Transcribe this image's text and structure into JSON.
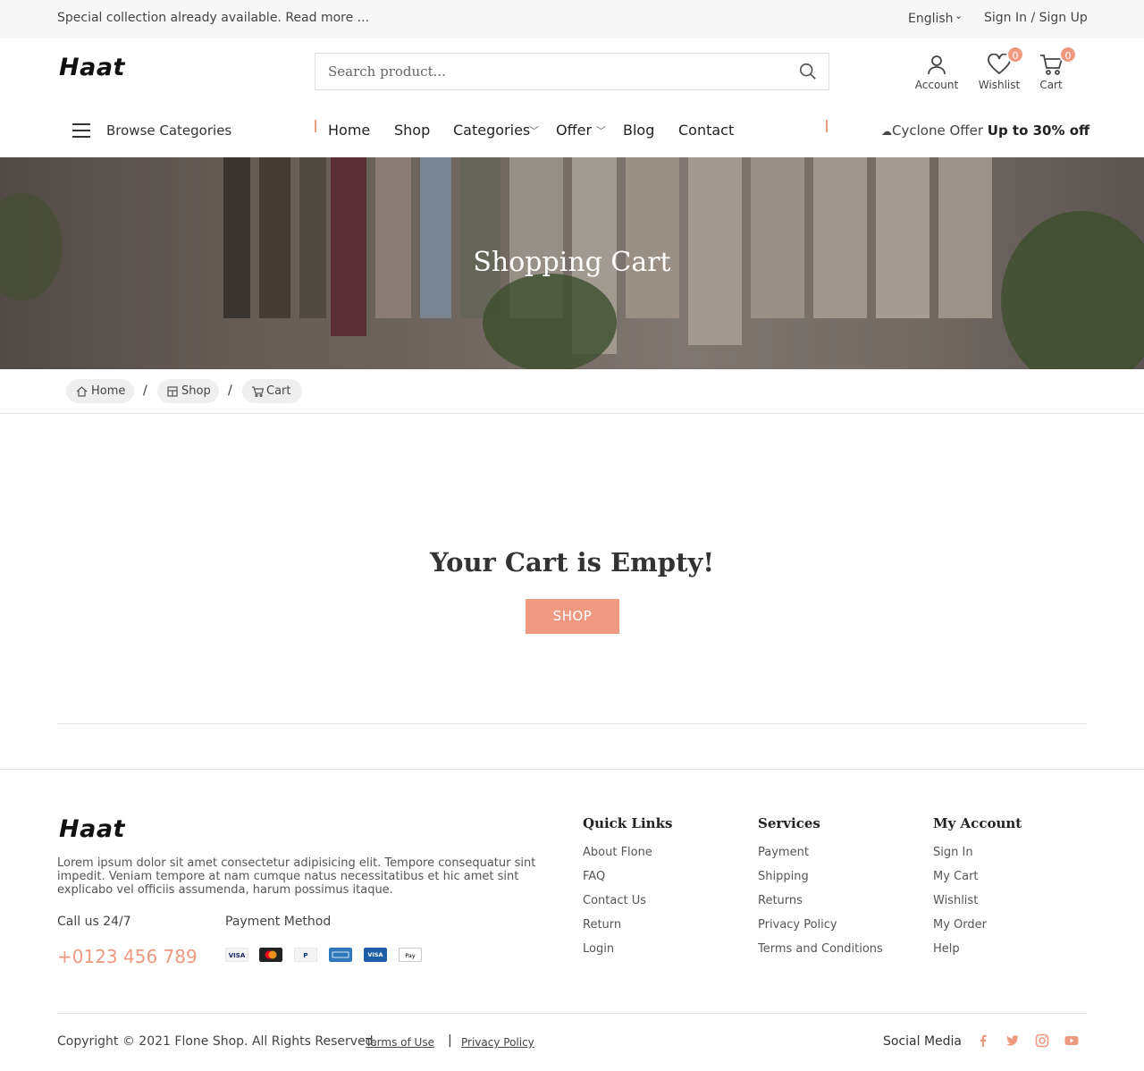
{
  "topbar": {
    "promo": "Special collection already available. Read more ...",
    "language": "English",
    "auth": "Sign In / Sign Up"
  },
  "logo": "Haat",
  "search": {
    "placeholder": "Search product..."
  },
  "header_icons": {
    "account": "Account",
    "wishlist": "Wishlist",
    "wishlist_count": "0",
    "cart": "Cart",
    "cart_count": "0"
  },
  "nav": {
    "browse": "Browse Categories",
    "items": [
      "Home",
      "Shop",
      "Categories",
      "Offer",
      "Blog",
      "Contact"
    ],
    "offer_prefix": "Cyclone Offer",
    "offer_value": "Up to 30% off"
  },
  "hero": {
    "title": "Shopping Cart"
  },
  "breadcrumb": [
    "Home",
    "Shop",
    "Cart"
  ],
  "main": {
    "empty_title": "Your Cart is Empty!",
    "shop_button": "SHOP"
  },
  "footer": {
    "logo": "Haat",
    "description": "Lorem ipsum dolor sit amet consectetur adipisicing elit. Tempore consequatur sint impedit. Veniam tempore at nam cumque natus necessitatibus et hic amet sint explicabo vel officiis assumenda, harum possimus itaque.",
    "call_label": "Call us 24/7",
    "phone": "+0123 456 789",
    "payment_label": "Payment Method",
    "payment_methods": [
      "visa-icon",
      "mastercard-icon",
      "paypal-icon",
      "amex-icon",
      "visa-electron-icon",
      "apple-pay-icon"
    ],
    "columns": [
      {
        "title": "Quick Links",
        "links": [
          "About Flone",
          "FAQ",
          "Contact Us",
          "Return",
          "Login"
        ]
      },
      {
        "title": "Services",
        "links": [
          "Payment",
          "Shipping",
          "Returns",
          "Privacy Policy",
          "Terms and Conditions"
        ]
      },
      {
        "title": "My Account",
        "links": [
          "Sign In",
          "My Cart",
          "Wishlist",
          "My Order",
          "Help"
        ]
      }
    ],
    "copyright": "Copyright © 2021 Flone Shop. All Rights Reserved.",
    "terms": "Terms of Use",
    "separator": "|",
    "privacy": "Privacy Policy",
    "social_label": "Social Media",
    "social_icons": [
      "facebook-icon",
      "twitter-icon",
      "instagram-icon",
      "youtube-icon"
    ]
  },
  "colors": {
    "accent": "#ef9a80",
    "topbar_bg": "#f7f7f7",
    "text": "#333333"
  }
}
